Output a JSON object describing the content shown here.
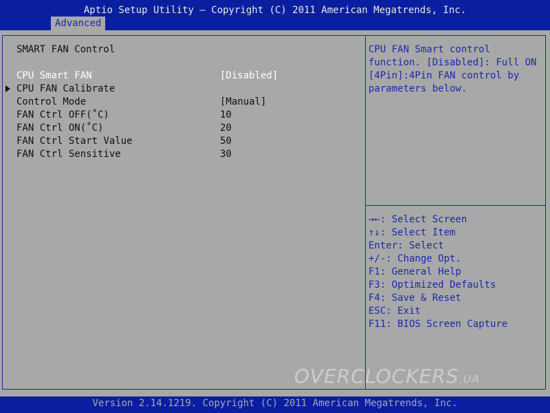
{
  "header": {
    "title": "Aptio Setup Utility – Copyright (C) 2011 American Megatrends, Inc.",
    "active_tab": "Advanced"
  },
  "main": {
    "section_title": "SMART FAN Control",
    "items": [
      {
        "label": "CPU Smart FAN",
        "value": "[Disabled]"
      },
      {
        "label": "CPU FAN Calibrate",
        "value": ""
      },
      {
        "label": "Control Mode",
        "value": "[Manual]"
      },
      {
        "label": "FAN Ctrl OFF(˚C)",
        "value": "10"
      },
      {
        "label": "FAN Ctrl ON(˚C)",
        "value": "20"
      },
      {
        "label": "FAN Ctrl Start Value",
        "value": "50"
      },
      {
        "label": "FAN Ctrl Sensitive",
        "value": "30"
      }
    ]
  },
  "help": {
    "description": [
      "CPU FAN Smart control",
      "function. [Disabled]: Full ON",
      "[4Pin]:4Pin FAN control by",
      "parameters below."
    ],
    "keys": [
      "→←: Select Screen",
      "↑↓: Select Item",
      "Enter: Select",
      "+/-: Change Opt.",
      "F1: General Help",
      "F3: Optimized Defaults",
      "F4: Save & Reset",
      "ESC: Exit",
      "F11: BIOS Screen Capture"
    ]
  },
  "watermark": {
    "main": "OVERCLOCKERS",
    "tld": ".UA"
  },
  "footer": {
    "version": "Version 2.14.1219. Copyright (C) 2011 American Megatrends, Inc."
  },
  "colors": {
    "bar_blue": "#0a1fa0",
    "panel_gray": "#a8a8a8",
    "help_text_blue": "#1a2aa8",
    "selected_text": "#ffffff"
  }
}
